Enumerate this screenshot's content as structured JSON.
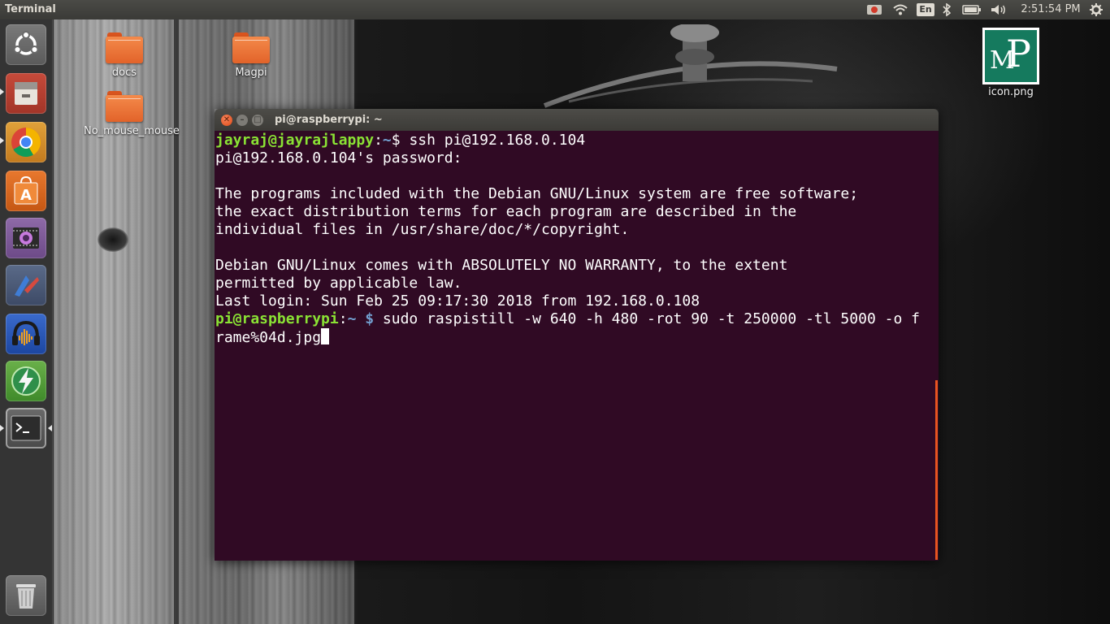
{
  "panel": {
    "title": "Terminal",
    "clock": "2:51:54 PM",
    "language": "En"
  },
  "desktop_icons": [
    {
      "label": "docs"
    },
    {
      "label": "Magpi"
    },
    {
      "label": "No_mouse_mouse"
    },
    {
      "label": "icon.png"
    }
  ],
  "mp_icon_text": {
    "m": "M",
    "p": "P"
  },
  "launcher": [
    {
      "name": "ubuntu-dash-icon"
    },
    {
      "name": "files-icon"
    },
    {
      "name": "chrome-icon"
    },
    {
      "name": "software-center-icon"
    },
    {
      "name": "video-editor-icon"
    },
    {
      "name": "app-icon"
    },
    {
      "name": "audacity-icon"
    },
    {
      "name": "downloader-icon"
    },
    {
      "name": "terminal-icon"
    },
    {
      "name": "trash-icon"
    }
  ],
  "terminal": {
    "title": "pi@raspberrypi: ~",
    "line1": {
      "user": "jayraj@jayrajlappy",
      "sep": ":",
      "path": "~",
      "cmd": "$ ssh pi@192.168.0.104"
    },
    "line2": "pi@192.168.0.104's password:",
    "line3": "",
    "line4": "The programs included with the Debian GNU/Linux system are free software;",
    "line5": "the exact distribution terms for each program are described in the",
    "line6": "individual files in /usr/share/doc/*/copyright.",
    "line7": "",
    "line8": "Debian GNU/Linux comes with ABSOLUTELY NO WARRANTY, to the extent",
    "line9": "permitted by applicable law.",
    "line10": "Last login: Sun Feb 25 09:17:30 2018 from 192.168.0.108",
    "line11": {
      "user": "pi@raspberrypi",
      "sep": ":",
      "path": "~ $",
      "cmd": " sudo raspistill -w 640 -h 480 -rot 90 -t 250000 -tl 5000 -o f"
    },
    "line12": "rame%04d.jpg"
  },
  "colors": {
    "terminal_bg": "#300a24",
    "prompt_user": "#8ae234",
    "prompt_path": "#729fcf",
    "folder": "#e2632a",
    "accent": "#e95420"
  }
}
